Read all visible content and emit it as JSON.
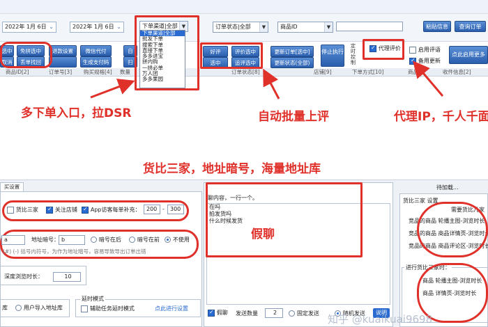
{
  "toolbar": {
    "date_start": "2022年 1月 6日",
    "date_end": "2022年 1月 6日",
    "channel_combo": "下单渠道|全部",
    "order_status_combo": "订单状态|全部",
    "product_id_combo": "商品ID",
    "paste_info": "粘贴信息",
    "query_orders": "查询订单",
    "row1_buttons": [
      "选中",
      "免拼选中",
      "退款设置",
      "微信代付",
      "自"
    ],
    "row2_buttons": [
      "取消",
      "丢单找回",
      "生成支付码",
      "扫"
    ],
    "mid_buttons_top": [
      "好评",
      "评价选中"
    ],
    "mid_buttons_bottom": [
      "选中",
      "追评选中"
    ],
    "update_order_selected": "更新订单[选中]",
    "update_status_all": "更新状态(全部)",
    "stop_execute": "停止执行",
    "timed_label": "定时控制",
    "proxy_review": "代理评价",
    "use_review_words": "启用评语",
    "alternate_update": "备用更新",
    "click_enable_more": "点此启用更多"
  },
  "dropdown": {
    "options": [
      "下单渠道|全部",
      "批发下单",
      "搜索下单",
      "直接下单",
      "多多进宝",
      "拼内购",
      "一拼必单",
      "万人团",
      "多多果园"
    ]
  },
  "grid": {
    "headers": [
      "商品ID[2]",
      "订单号[3]",
      "购买规格[4]",
      "数量",
      "订单状态[8]",
      "店铺[9]",
      "下单方式[10]",
      "商品标",
      "收件信息[2]"
    ]
  },
  "callouts": {
    "multi_entry": "多下单入口，拉DSR",
    "auto_review": "自动批量上评",
    "proxy_ip": "代理IP，千人千面",
    "compare": "货比三家，地址暗号，海量地址库",
    "fake_chat": "假聊"
  },
  "lower": {
    "tab_label": "买设置",
    "compare_three": "货比三家",
    "follow_shop": "关注店铺",
    "app_visit": "App访客每单补充：",
    "app_visit_min": "200",
    "app_visit_dash": "-",
    "app_visit_max": "300",
    "addr_prefix": "a",
    "addr_code_label": "地址暗号：",
    "addr_code_value": "b",
    "code_after": "暗号在后",
    "code_before": "暗号在前",
    "no_use": "不使用",
    "hint": "(#)  (-)  括号内符号，为作为地址暗号，容易导致导出订单出错",
    "deep_browse": "深度浏览时长：",
    "deep_browse_value": "10",
    "delay_mode": "延时模式",
    "assist_delay": "辅助任务延时模式",
    "click_delay": "点此进行设置",
    "library": "库",
    "user_import": "用户导入地址库",
    "chat_title": "聊内容，一行一个。",
    "chat_lines": [
      "在吗",
      "拍发货吗",
      "什么时候发货"
    ],
    "fake_chat_cb": "假聊",
    "send_count_label": "发送数量",
    "send_count_value": "2",
    "fixed_send": "固定发送",
    "random_send": "随机发送",
    "explain": "说明",
    "waiting": "待加载...",
    "compare_settings": "货比三家 设置",
    "need_browse": "需要货比几家",
    "shop_items": [
      "竞品的商品 轮播主图-浏览时长",
      "竞品的商品 商品详情页-浏览时长",
      "竞品的商品 商品评论区-浏览时长"
    ],
    "before_compare": "进行货比三家时：",
    "after_items": [
      "商品 轮播主图-浏览时长",
      "商品 详情页-浏览时长"
    ]
  },
  "watermark": "知乎 @kuaikuai9698"
}
